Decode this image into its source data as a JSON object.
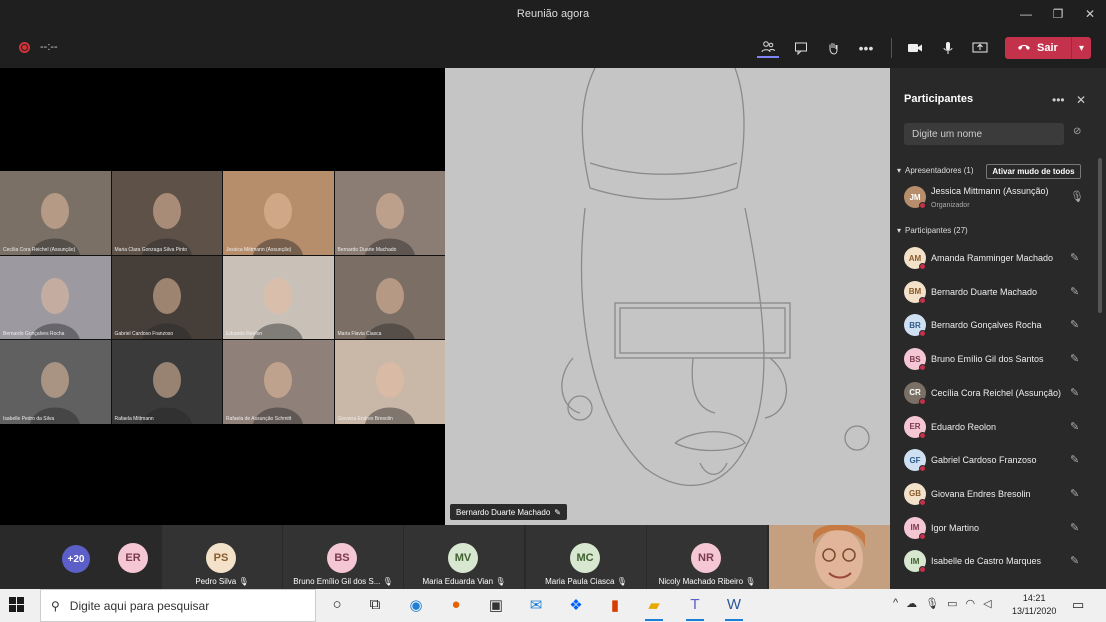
{
  "window": {
    "title": "Reunião agora",
    "controls": [
      "—",
      "❐",
      "✕"
    ]
  },
  "toolbar": {
    "timer": "--:--",
    "leave_label": "Sair",
    "icons": [
      "participants-icon",
      "chat-icon",
      "raise-hand-icon",
      "more-icon",
      "camera-icon",
      "mic-icon",
      "share-icon"
    ]
  },
  "grid": [
    {
      "name": "Cecília Cora Reichel (Assunção)",
      "color": "#7a7066"
    },
    {
      "name": "Maria Clara Gonzaga Silva Pinto",
      "color": "#5e5148"
    },
    {
      "name": "Jessica Mittmann (Assunção)",
      "color": "#b78e6c"
    },
    {
      "name": "Bernardo Duarte Machado",
      "color": "#8c7d74"
    },
    {
      "name": "Bernardo Gonçalves Rocha",
      "color": "#9c9aa0"
    },
    {
      "name": "Gabriel Cardoso Franzoso",
      "color": "#453e39"
    },
    {
      "name": "Eduardo Reolon",
      "color": "#c9c1b8"
    },
    {
      "name": "Maria Flavia Ciasca",
      "color": "#7b6e64"
    },
    {
      "name": "Isabelle Pedro da Silva",
      "color": "#606060"
    },
    {
      "name": "Rafaela Mittmann",
      "color": "#3a3a3a"
    },
    {
      "name": "Rafaela de Assunção Schmitt",
      "color": "#8f8079"
    },
    {
      "name": "Giovana Endres Bresolin",
      "color": "#c9b7a8"
    }
  ],
  "share": {
    "presenter": "Bernardo Duarte Machado"
  },
  "strip": {
    "more_count": "+20",
    "er_initials": "ER",
    "tiles": [
      {
        "initials": "PS",
        "name": "Pedro Silva",
        "bg": "#f3e1c9",
        "fg": "#8a5b2b"
      },
      {
        "initials": "BS",
        "name": "Bruno Emílio Gil dos S...",
        "bg": "#f5c6d4",
        "fg": "#7a3a50"
      },
      {
        "initials": "MV",
        "name": "Maria Eduarda Vian",
        "bg": "#d8e7cf",
        "fg": "#3f6030"
      },
      {
        "initials": "MC",
        "name": "Maria Paula Ciasca",
        "bg": "#d8e7cf",
        "fg": "#3f6030"
      },
      {
        "initials": "NR",
        "name": "Nicoly Machado Ribeiro",
        "bg": "#f5c6d4",
        "fg": "#7a3a50"
      }
    ]
  },
  "panel": {
    "title": "Participantes",
    "search_placeholder": "Digite um nome",
    "presenters_label": "Apresentadores (1)",
    "mute_all": "Ativar mudo de todos",
    "participants_label": "Participantes (27)",
    "presenters": [
      {
        "initials": "JM",
        "name": "Jessica Mittmann (Assunção)",
        "sub": "Organizador",
        "bg": "#b78e6c",
        "fg": "#fff"
      }
    ],
    "participants": [
      {
        "initials": "AM",
        "name": "Amanda Ramminger Machado",
        "bg": "#f3e1c9",
        "fg": "#8a5b2b"
      },
      {
        "initials": "BM",
        "name": "Bernardo Duarte Machado",
        "bg": "#f3e1c9",
        "fg": "#8a5b2b"
      },
      {
        "initials": "BR",
        "name": "Bernardo Gonçalves Rocha",
        "bg": "#cfe0f3",
        "fg": "#2f5b8a"
      },
      {
        "initials": "BS",
        "name": "Bruno Emílio Gil dos Santos",
        "bg": "#f5c6d4",
        "fg": "#7a3a50"
      },
      {
        "initials": "CR",
        "name": "Cecília Cora Reichel (Assunção)",
        "bg": "#7a7066",
        "fg": "#fff"
      },
      {
        "initials": "ER",
        "name": "Eduardo Reolon",
        "bg": "#f5c6d4",
        "fg": "#7a3a50"
      },
      {
        "initials": "GF",
        "name": "Gabriel Cardoso Franzoso",
        "bg": "#cfe0f3",
        "fg": "#2f5b8a"
      },
      {
        "initials": "GB",
        "name": "Giovana Endres Bresolin",
        "bg": "#f3e1c9",
        "fg": "#8a5b2b"
      },
      {
        "initials": "IM",
        "name": "Igor Martino",
        "bg": "#f5c6d4",
        "fg": "#7a3a50"
      },
      {
        "initials": "IM",
        "name": "Isabelle de Castro Marques",
        "bg": "#d8e7cf",
        "fg": "#3f6030"
      }
    ]
  },
  "taskbar": {
    "search_placeholder": "Digite aqui para pesquisar",
    "time": "14:21",
    "date": "13/11/2020"
  }
}
